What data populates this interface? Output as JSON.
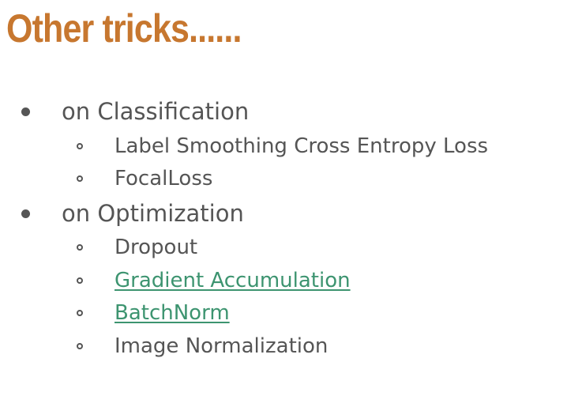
{
  "slide": {
    "title": "Other tricks......",
    "items": [
      {
        "label": "on Classification",
        "level": 1
      },
      {
        "label": "Label Smoothing Cross Entropy Loss",
        "level": 2
      },
      {
        "label": "FocalLoss",
        "level": 2
      },
      {
        "label": "on Optimization",
        "level": 1
      },
      {
        "label": "Dropout",
        "level": 2
      },
      {
        "label": "Gradient Accumulation",
        "level": 2,
        "link": true
      },
      {
        "label": "BatchNorm",
        "level": 2,
        "link": true
      },
      {
        "label": "Image Normalization",
        "level": 2
      }
    ]
  },
  "colors": {
    "title": "#c7772f",
    "text": "#555555",
    "link": "#3d9470"
  }
}
